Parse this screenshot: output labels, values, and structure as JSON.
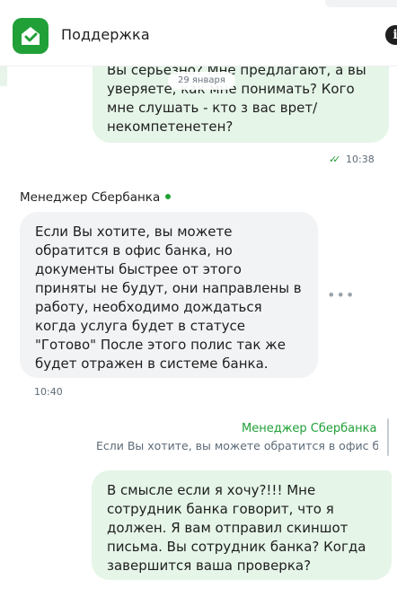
{
  "header": {
    "title": "Поддержка",
    "info_icon": "info-icon"
  },
  "date_divider": "29 января",
  "messages": [
    {
      "direction": "outgoing",
      "lines": [
        "Вы серьезно? Мне предлагают, а вы",
        "уверяете, как мне понимать? Кого",
        "мне слушать - кто з вас врет/",
        "некомпетенетен?"
      ],
      "time": "10:38",
      "status_icon": "double-check-icon"
    },
    {
      "direction": "incoming",
      "sender": "Менеджер Сбербанка",
      "lines": [
        "Если Вы хотите, вы можете",
        "обратится в офис банка, но",
        "документы быстрее от этого",
        "приняты не будут, они направлены в",
        "работу, необходимо дождаться",
        "когда услуга будет в статусе",
        "\"Готово\" После этого полис так же",
        "будет отражен в системе банка."
      ],
      "time": "10:40"
    },
    {
      "direction": "outgoing",
      "reply_to": {
        "author": "Менеджер Сбербанка",
        "text": "Если Вы хотите, вы можете обратится в офис банка, но"
      },
      "lines": [
        "В смысле если я хочу?!!! Мне",
        "сотрудник банка говорит, что я",
        "должен. Я вам отправил скиншот",
        "письма. Вы сотрудник банка? Когда",
        "завершится ваша проверка?"
      ]
    }
  ],
  "colors": {
    "accent": "#21a038",
    "outgoing_bubble": "#e5f5e8",
    "incoming_bubble": "#f2f3f5"
  }
}
